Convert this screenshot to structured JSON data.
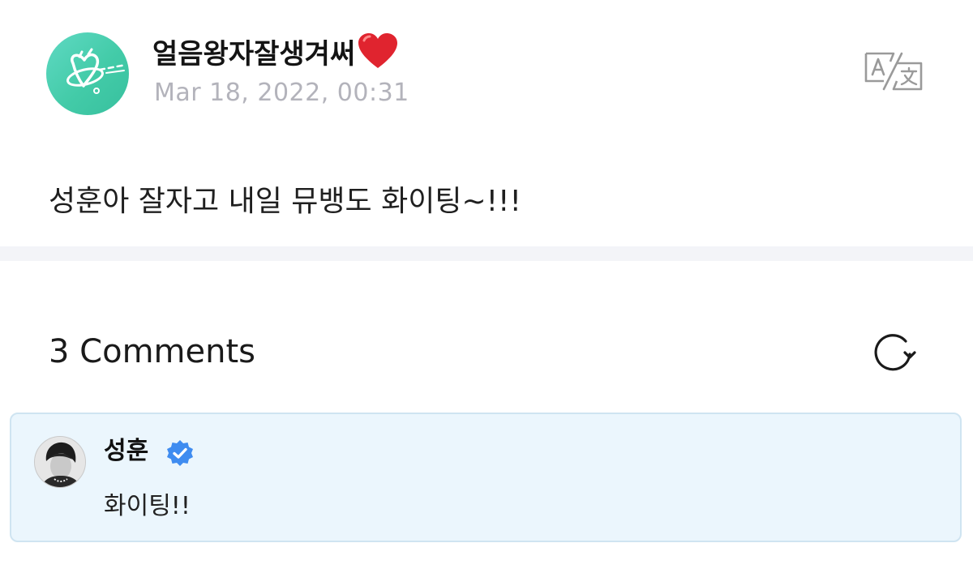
{
  "post": {
    "author": "얼음왕자잘생겨써",
    "author_emoji": "heart-emoji",
    "date": "Mar 18, 2022, 00:31",
    "body": "성훈아 잘자고 내일 뮤뱅도 화이팅~!!!",
    "avatar_color": "#43cba8"
  },
  "header_actions": {
    "translate_icon": "translate-icon"
  },
  "comments": {
    "title": "3 Comments",
    "refresh_icon": "refresh-icon",
    "items": [
      {
        "author": "성훈",
        "verified": true,
        "text": "화이팅!!",
        "highlight_color": "#ebf6fd"
      }
    ]
  },
  "colors": {
    "verified_badge": "#3f8cf0",
    "date_text": "#b3b3bb",
    "divider": "#f3f4f8",
    "heart": "#e0242f"
  }
}
